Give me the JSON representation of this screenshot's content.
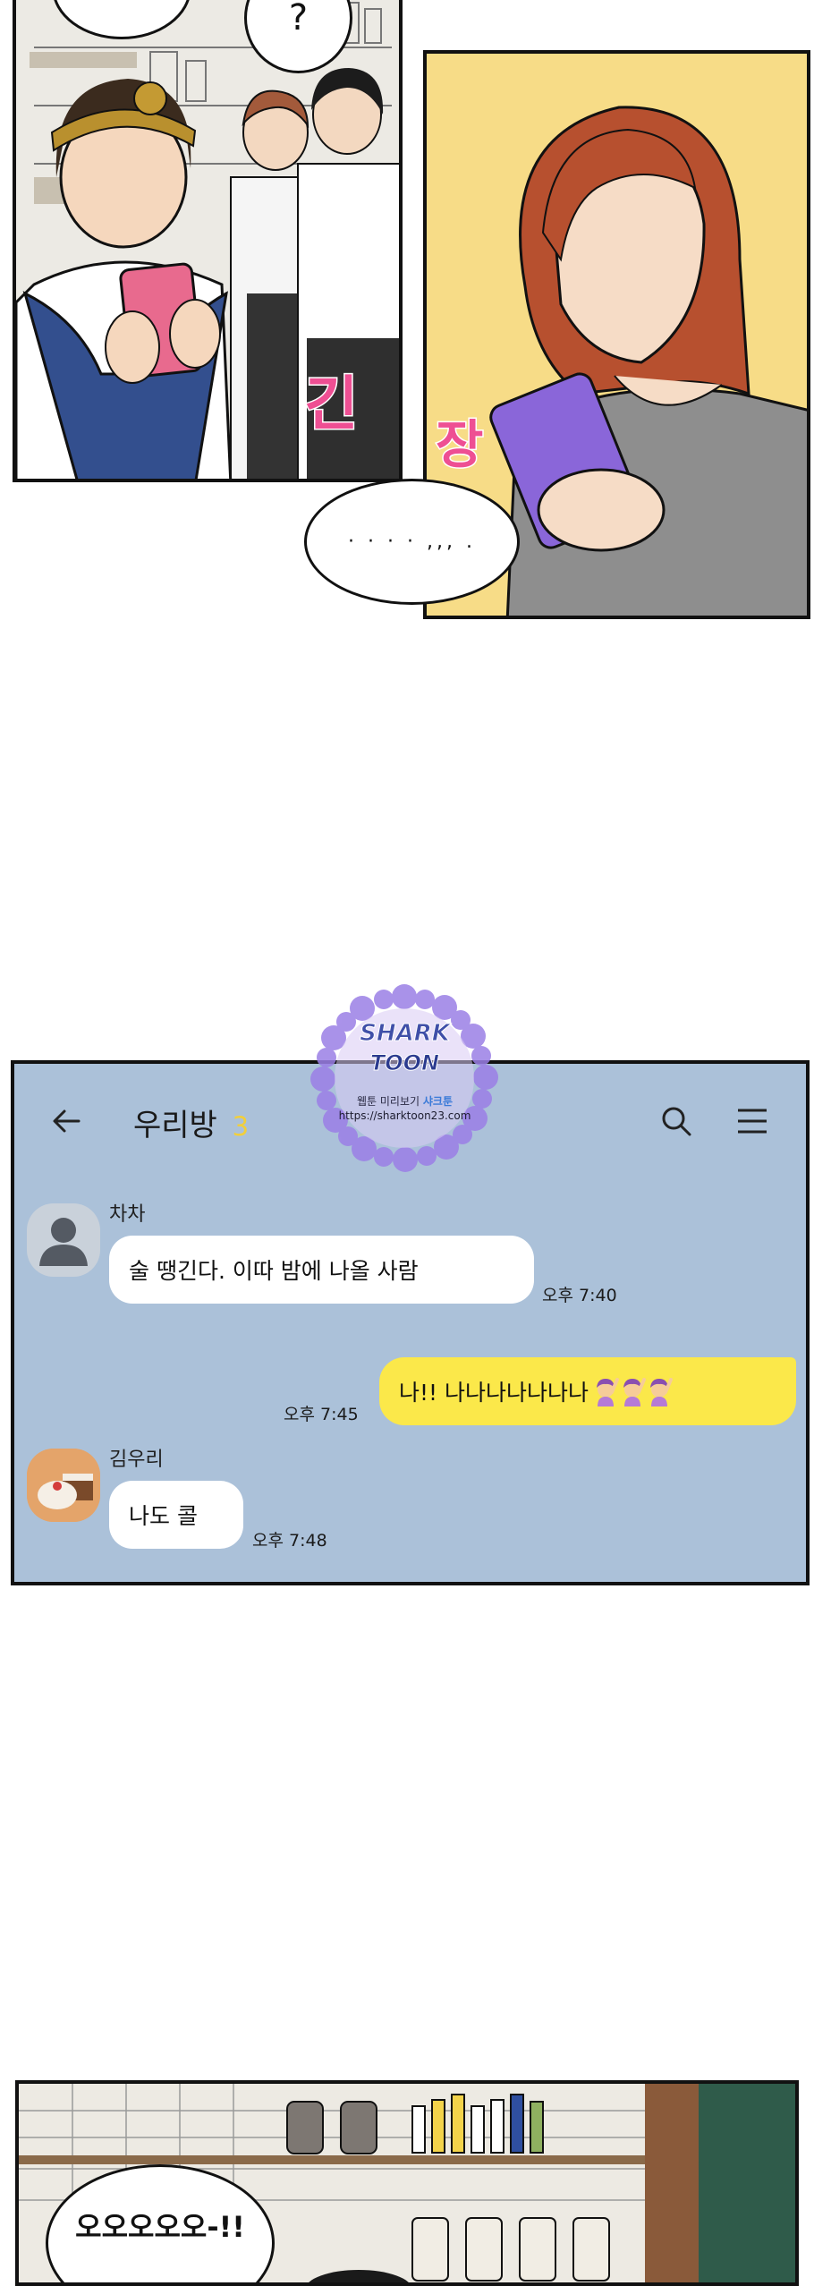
{
  "panel_top_left": {
    "speech_question": "?",
    "sfx": "긴"
  },
  "panel_top_right": {
    "sfx": "장",
    "speech": "· · · · ,,, ."
  },
  "watermark": {
    "logo_line1": "SHARK",
    "logo_line2": "TOON",
    "tagline_prefix": "웹툰 미리보기",
    "tagline_brand": "샤크툰",
    "url": "https://sharktoon23.com"
  },
  "chat": {
    "room_title": "우리방",
    "member_count": "3",
    "colors": {
      "background": "#abc1d9",
      "my_bubble": "#fbe84a",
      "other_bubble": "#ffffff",
      "count": "#f2cf3a"
    },
    "messages": [
      {
        "sender": "차차",
        "avatar": "default-user-avatar",
        "text": "술 땡긴다. 이따 밤에 나올 사람",
        "time": "오후 7:40"
      },
      {
        "sender": "me",
        "text": "나!! 나나나나나나나",
        "emoji": [
          "raising-hand-emoji",
          "raising-hand-emoji",
          "raising-hand-emoji"
        ],
        "time": "오후 7:45"
      },
      {
        "sender": "김우리",
        "avatar": "cake-photo-avatar",
        "text": "나도 콜",
        "time": "오후 7:48"
      }
    ]
  },
  "panel_bottom": {
    "speech": "오오오오오-!!"
  }
}
